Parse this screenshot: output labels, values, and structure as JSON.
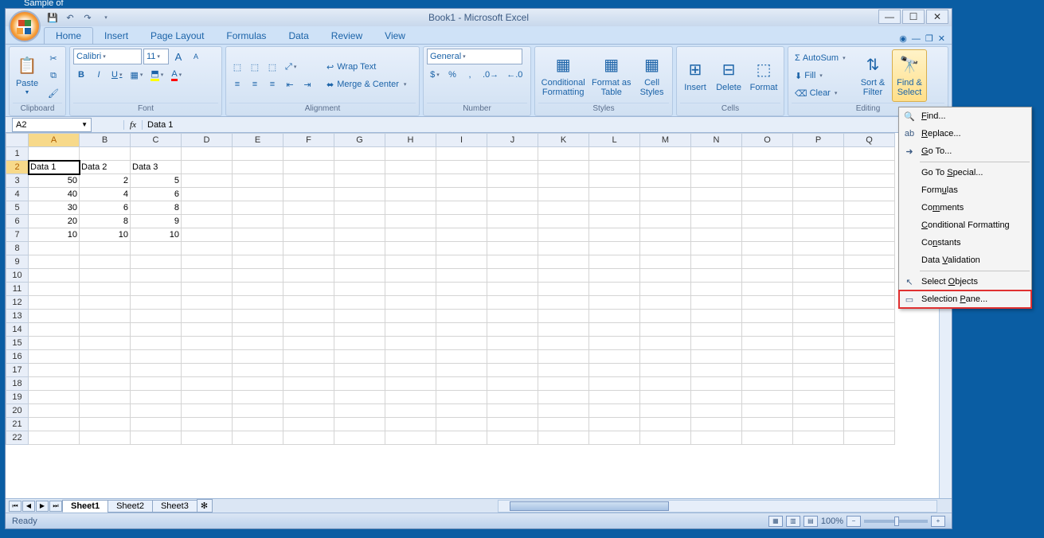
{
  "taskbar_hint": "Sample of",
  "title": "Book1 - Microsoft Excel",
  "tabs": {
    "home": "Home",
    "insert": "Insert",
    "page_layout": "Page Layout",
    "formulas": "Formulas",
    "data": "Data",
    "review": "Review",
    "view": "View"
  },
  "ribbon": {
    "clipboard": {
      "title": "Clipboard",
      "paste": "Paste"
    },
    "font": {
      "title": "Font",
      "name": "Calibri",
      "size": "11",
      "bold": "B",
      "italic": "I",
      "underline": "U"
    },
    "alignment": {
      "title": "Alignment",
      "wrap": "Wrap Text",
      "merge": "Merge & Center"
    },
    "number": {
      "title": "Number",
      "format": "General"
    },
    "styles": {
      "title": "Styles",
      "cond": "Conditional Formatting",
      "table": "Format as Table",
      "cell": "Cell Styles"
    },
    "cells": {
      "title": "Cells",
      "insert": "Insert",
      "delete": "Delete",
      "format": "Format"
    },
    "editing": {
      "title": "Editing",
      "autosum": "AutoSum",
      "fill": "Fill",
      "clear": "Clear",
      "sort": "Sort & Filter",
      "find": "Find & Select"
    }
  },
  "name_box": "A2",
  "formula_bar": "Data 1",
  "columns": [
    "A",
    "B",
    "C",
    "D",
    "E",
    "F",
    "G",
    "H",
    "I",
    "J",
    "K",
    "L",
    "M",
    "N",
    "O",
    "P",
    "Q"
  ],
  "row_headers": [
    "1",
    "2",
    "3",
    "4",
    "5",
    "6",
    "7",
    "8",
    "9",
    "10",
    "11",
    "12",
    "13",
    "14",
    "15",
    "16",
    "17",
    "18",
    "19",
    "20",
    "21",
    "22"
  ],
  "cells": {
    "A2": "Data 1",
    "B2": "Data 2",
    "C2": "Data 3",
    "A3": "50",
    "B3": "2",
    "C3": "5",
    "A4": "40",
    "B4": "4",
    "C4": "6",
    "A5": "30",
    "B5": "6",
    "C5": "8",
    "A6": "20",
    "B6": "8",
    "C6": "9",
    "A7": "10",
    "B7": "10",
    "C7": "10"
  },
  "sheet_tabs": {
    "s1": "Sheet1",
    "s2": "Sheet2",
    "s3": "Sheet3"
  },
  "status": {
    "ready": "Ready",
    "zoom": "100%"
  },
  "menu": {
    "find": "Find...",
    "replace": "Replace...",
    "goto": "Go To...",
    "special": "Go To Special...",
    "formulas": "Formulas",
    "comments": "Comments",
    "cond": "Conditional Formatting",
    "constants": "Constants",
    "validation": "Data Validation",
    "objects": "Select Objects",
    "pane": "Selection Pane..."
  }
}
